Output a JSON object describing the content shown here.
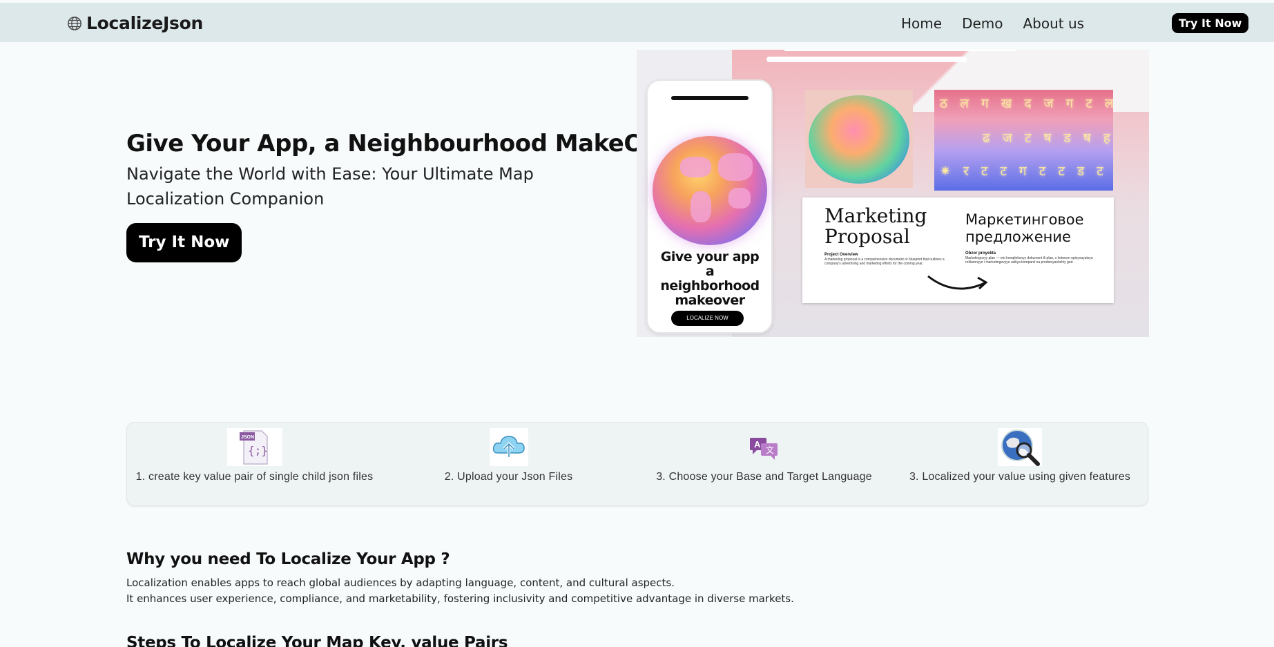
{
  "brand": {
    "name": "LocalizeJson"
  },
  "nav": {
    "links": [
      "Home",
      "Demo",
      "About us"
    ],
    "cta": "Try It Now"
  },
  "hero": {
    "title": "Give Your App, a Neighbourhood MakeOver.",
    "subtitle": "Navigate the World with Ease: Your Ultimate Map Localization Companion",
    "cta": "Try It Now",
    "illustration": {
      "phone_text": "Give your app a neighborhood makeover",
      "phone_button": "LOCALIZE NOW",
      "doc_title_en": "Marketing Proposal",
      "doc_title_ru": "Маркетинговое предложение",
      "doc_sub_en": "Project Overview",
      "doc_sub_ru": "Obzor proyekta",
      "doc_body_en": "A marketing proposal is a comprehensive document or blueprint that outlines a company's advertising and marketing efforts for the coming year.",
      "doc_body_ru": "Marketingovyy plan — eto kompleksnyy dokument ili plan, v kotorom opisyvayutsya reklamnyye i marketingovyye usiliya kompanii na predstoyashchiy god."
    }
  },
  "steps": [
    {
      "label": "1. create key value pair of single child json files",
      "icon": "json-file-icon"
    },
    {
      "label": "2. Upload your Json Files",
      "icon": "cloud-upload-icon"
    },
    {
      "label": "3. Choose your Base and Target Language",
      "icon": "translate-icon"
    },
    {
      "label": "3. Localized your value using given features",
      "icon": "globe-search-icon"
    }
  ],
  "why": {
    "title": "Why you need To Localize Your App ?",
    "p1": "Localization enables apps to reach global audiences by adapting language, content, and cultural aspects.",
    "p2": "It enhances user experience, compliance, and marketability, fostering inclusivity and competitive advantage in diverse markets."
  },
  "steps_section": {
    "title": "Steps To Localize Your Map Key, value Pairs"
  },
  "colors": {
    "navbar_bg": "#dde8ea",
    "page_bg": "#f7fbfc",
    "button_bg": "#000000",
    "steps_bg": "#eef3f4"
  }
}
